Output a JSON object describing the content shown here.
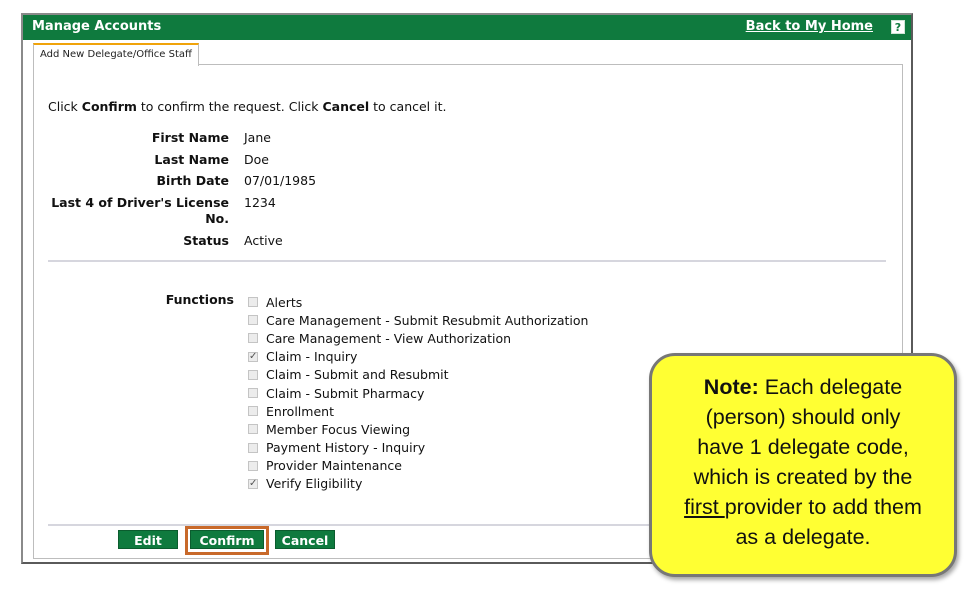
{
  "window": {
    "title": "Manage Accounts",
    "back_link": "Back to My Home",
    "help_glyph": "?"
  },
  "tab": {
    "label": "Add New Delegate/Office Staff"
  },
  "instructions": {
    "part1": "Click ",
    "confirm_word": "Confirm",
    "part2": " to confirm the request. Click ",
    "cancel_word": "Cancel",
    "part3": " to cancel it."
  },
  "fields": [
    {
      "label": "First Name",
      "value": "Jane"
    },
    {
      "label": "Last Name",
      "value": "Doe"
    },
    {
      "label": "Birth Date",
      "value": "07/01/1985"
    },
    {
      "label": "Last 4 of Driver's License No.",
      "value": "1234"
    },
    {
      "label": "Status",
      "value": "Active"
    }
  ],
  "functions": {
    "label": "Functions",
    "items": [
      {
        "label": "Alerts",
        "checked": false
      },
      {
        "label": "Care Management - Submit Resubmit Authorization",
        "checked": false
      },
      {
        "label": "Care Management - View Authorization",
        "checked": false
      },
      {
        "label": "Claim - Inquiry",
        "checked": true
      },
      {
        "label": "Claim - Submit and Resubmit",
        "checked": false
      },
      {
        "label": "Claim - Submit Pharmacy",
        "checked": false
      },
      {
        "label": "Enrollment",
        "checked": false
      },
      {
        "label": "Member Focus Viewing",
        "checked": false
      },
      {
        "label": "Payment History - Inquiry",
        "checked": false
      },
      {
        "label": "Provider Maintenance",
        "checked": false
      },
      {
        "label": "Verify Eligibility",
        "checked": true
      }
    ]
  },
  "buttons": {
    "edit": "Edit",
    "confirm": "Confirm",
    "cancel": "Cancel"
  },
  "note": {
    "bold": "Note:",
    "line1_rest": " Each delegate",
    "line2": "(person) should only",
    "line3": "have 1 delegate code,",
    "line4": "which is created by the",
    "line5_underlined": "first ",
    "line5_rest": "provider to add them",
    "line6": "as a delegate."
  },
  "colors": {
    "header_green": "#0f7a3e",
    "tab_accent": "#f0a30a",
    "confirm_highlight": "#c8692a",
    "note_background": "#ffff33"
  }
}
